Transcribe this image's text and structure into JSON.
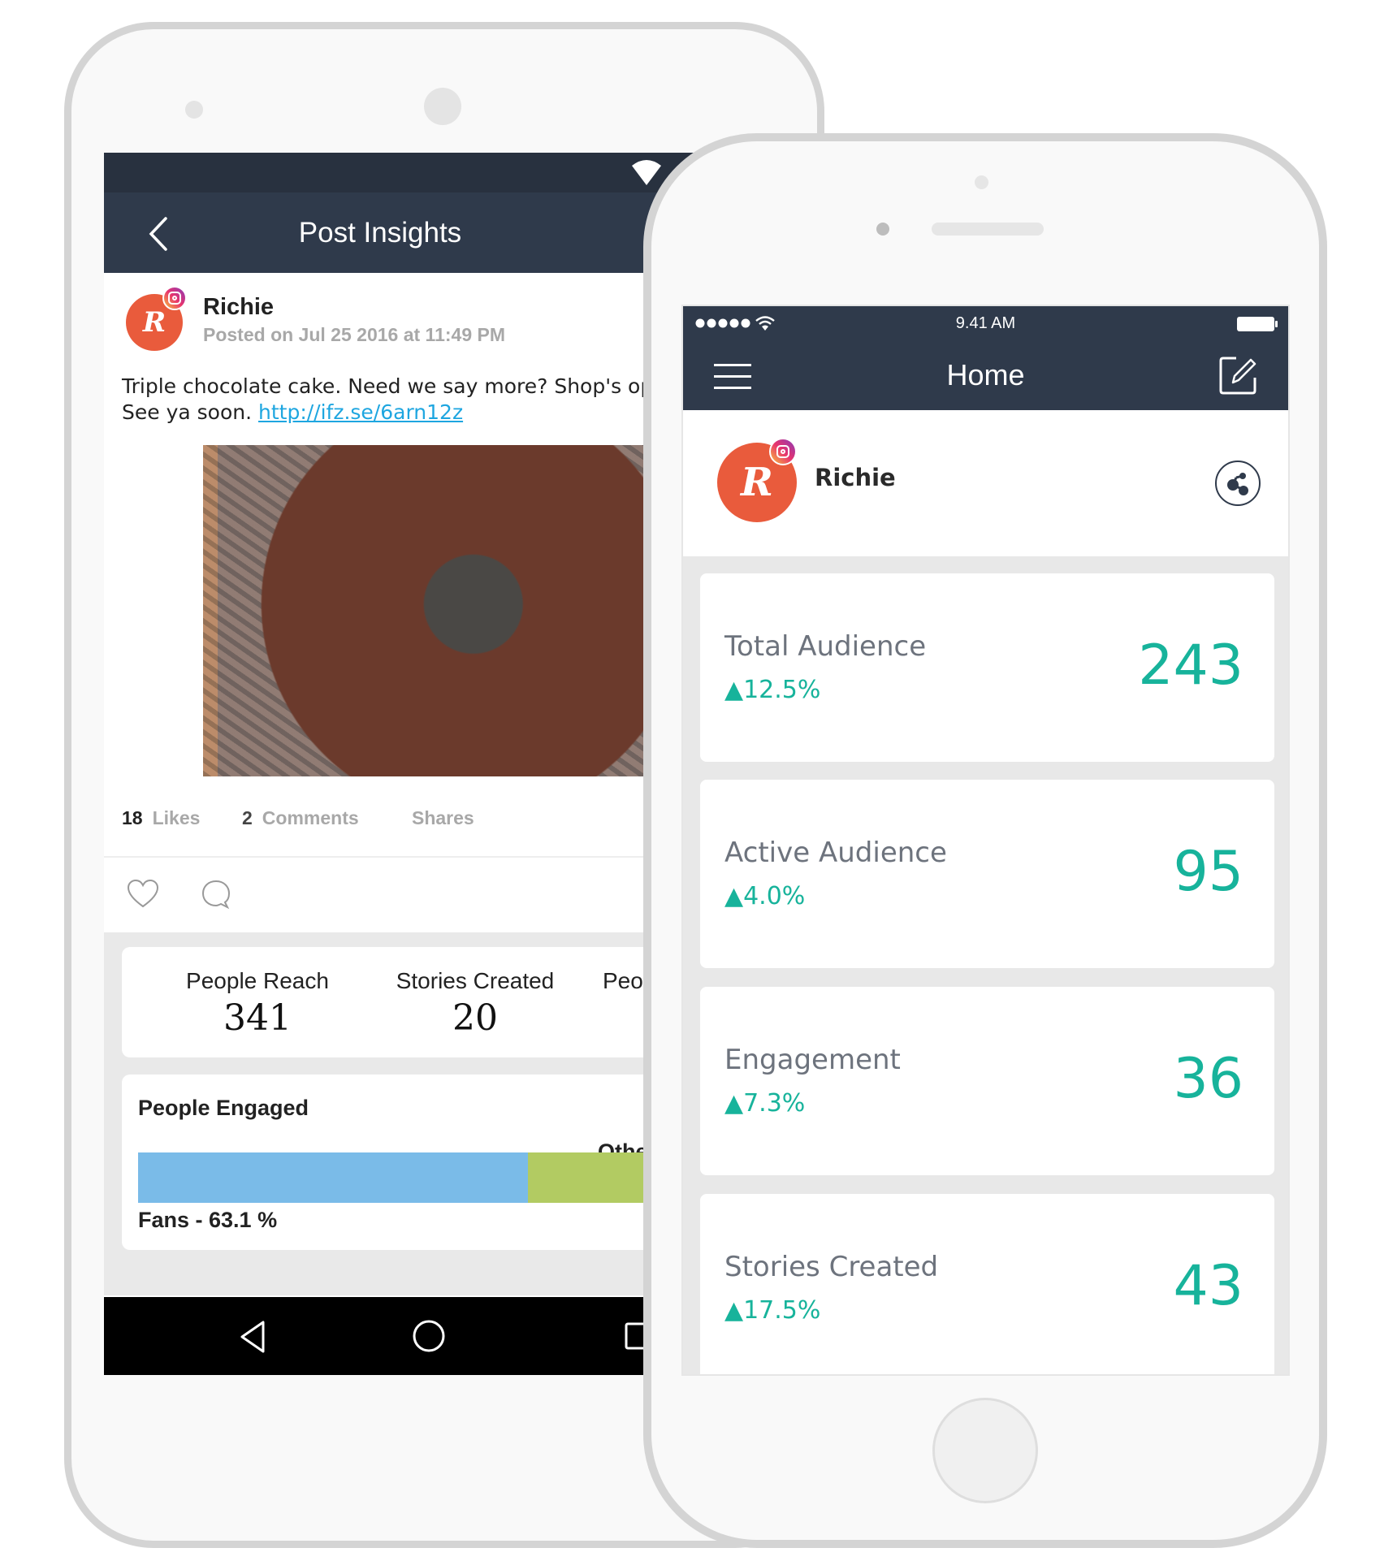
{
  "colors": {
    "navbar": "#2f3a4b",
    "accent_teal": "#17b39b",
    "avatar_orange": "#e95b3c",
    "link_blue": "#1ea6e0",
    "fans_bar": "#7abbe8",
    "other_bar": "#b2cb62"
  },
  "android": {
    "toolbar": {
      "title": "Post Insights",
      "back_icon": "chevron-left-icon"
    },
    "post": {
      "avatar_letter": "R",
      "author": "Richie",
      "posted_on": "Posted on  Jul 25 2016 at 11:49 PM",
      "text_line1": "Triple chocolate cake. Need we say more? Shop's ope",
      "text_line2_prefix": "See ya soon. ",
      "link": "http://ifz.se/6arn12z",
      "stats": {
        "likes_count": "18",
        "likes_label": "Likes",
        "comments_count": "2",
        "comments_label": "Comments",
        "shares_label": "Shares"
      }
    },
    "metrics": [
      {
        "label": "People Reach",
        "value": "341"
      },
      {
        "label": "Stories Created",
        "value": "20"
      },
      {
        "label": "Peo",
        "value": ""
      }
    ],
    "engaged": {
      "title": "People Engaged",
      "other_label": "Other",
      "fans_label": "Fans - 63.1 %",
      "fans_percent": 63.1
    }
  },
  "iphone": {
    "status": {
      "time": "9.41 AM"
    },
    "nav": {
      "title": "Home"
    },
    "profile": {
      "avatar_letter": "R",
      "name": "Richie"
    },
    "cards": [
      {
        "label": "Total Audience",
        "change": "▲12.5%",
        "value": "243"
      },
      {
        "label": "Active Audience",
        "change": "▲4.0%",
        "value": "95"
      },
      {
        "label": "Engagement",
        "change": "▲7.3%",
        "value": "36"
      },
      {
        "label": "Stories Created",
        "change": "▲17.5%",
        "value": "43"
      }
    ]
  }
}
